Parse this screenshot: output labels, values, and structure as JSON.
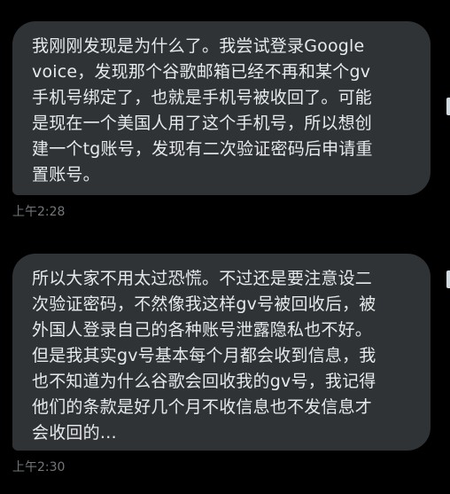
{
  "conversation": {
    "messages": [
      {
        "lines": [
          "我刚刚发现是为什么了。我尝试登录Google",
          "voice，发现那个谷歌邮箱已经不再和某个gv",
          "手机号绑定了，也就是手机号被收回了。可能",
          "是现在一个美国人用了这个手机号，所以想创",
          "建一个tg账号，发现有二次验证密码后申请重",
          "置账号。"
        ],
        "timestamp": "上午2:28"
      },
      {
        "lines": [
          "所以大家不用太过恐慌。不过还是要注意设二",
          "次验证密码，不然像我这样gv号被回收后，被",
          "外国人登录自己的各种账号泄露隐私也不好。",
          "但是我其实gv号基本每个月都会收到信息，我",
          "也不知道为什么谷歌会回收我的gv号，我记得",
          "他们的条款是好几个月不收信息也不发信息才",
          "会收回的…"
        ],
        "timestamp": "上午2:30"
      }
    ]
  },
  "colors": {
    "background": "#000000",
    "bubble": "#2f3336",
    "text": "#e7e9ea",
    "timestamp": "#71767b"
  }
}
